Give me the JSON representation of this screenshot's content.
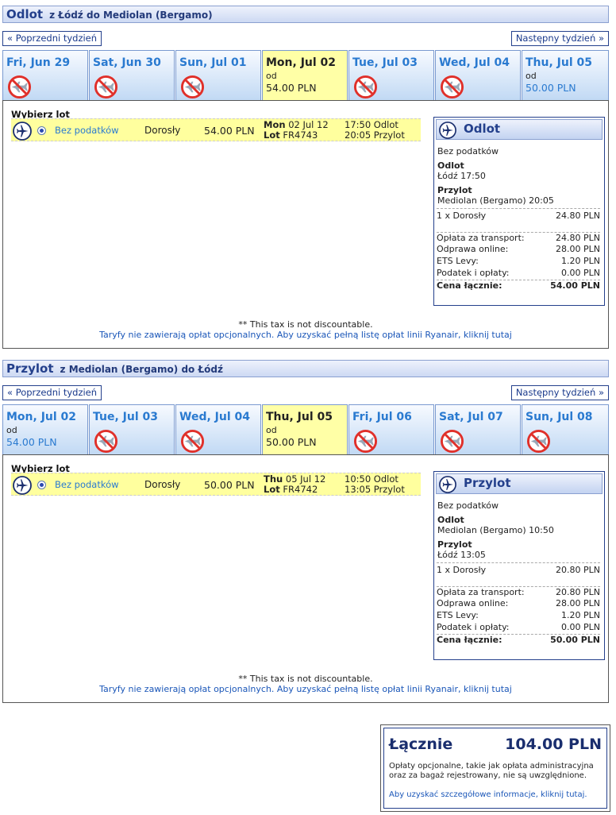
{
  "outbound": {
    "title": "Odlot",
    "route": "z Łódź do Mediolan (Bergamo)",
    "prev_week": "« Poprzedni tydzień",
    "next_week": "Następny tydzień »",
    "days": [
      {
        "label": "Fri, Jun 29",
        "available": false
      },
      {
        "label": "Sat, Jun 30",
        "available": false
      },
      {
        "label": "Sun, Jul 01",
        "available": false
      },
      {
        "label": "Mon, Jul 02",
        "available": true,
        "selected": true,
        "from": "od",
        "price": "54.00 PLN"
      },
      {
        "label": "Tue, Jul 03",
        "available": false
      },
      {
        "label": "Wed, Jul 04",
        "available": false
      },
      {
        "label": "Thu, Jul 05",
        "available": true,
        "selected": false,
        "from": "od",
        "price": "50.00 PLN"
      }
    ],
    "choose_flight": "Wybierz lot",
    "flight": {
      "fare": "Bez podatków",
      "pax": "Dorosły",
      "price": "54.00 PLN",
      "day": "Mon",
      "date": "02 Jul 12",
      "lot_label": "Lot",
      "flight_no": "FR4743",
      "dep": "17:50 Odlot",
      "arr": "20:05 Przylot"
    },
    "summary": {
      "title": "Odlot",
      "fare": "Bez podatków",
      "dep_label": "Odlot",
      "dep_value": "Łódź 17:50",
      "arr_label": "Przylot",
      "arr_value": "Mediolan (Bergamo) 20:05",
      "pax_label": "1 x Dorosły",
      "pax_value": "24.80 PLN",
      "rows": [
        {
          "label": "Opłata za transport:",
          "value": "24.80 PLN"
        },
        {
          "label": "Odprawa online:",
          "value": "28.00 PLN"
        },
        {
          "label": "ETS Levy:",
          "value": "1.20 PLN"
        },
        {
          "label": "Podatek i opłaty:",
          "value": "0.00 PLN"
        }
      ],
      "total_label": "Cena łącznie:",
      "total_value": "54.00 PLN"
    },
    "note1": "** This tax is not discountable.",
    "note2": "Taryfy nie zawierają opłat opcjonalnych. Aby uzyskać pełną listę opłat linii Ryanair, kliknij tutaj"
  },
  "inbound": {
    "title": "Przylot",
    "route": "z Mediolan (Bergamo) do Łódź",
    "prev_week": "« Poprzedni tydzień",
    "next_week": "Następny tydzień »",
    "days": [
      {
        "label": "Mon, Jul 02",
        "available": true,
        "selected": false,
        "from": "od",
        "price": "54.00 PLN"
      },
      {
        "label": "Tue, Jul 03",
        "available": false
      },
      {
        "label": "Wed, Jul 04",
        "available": false
      },
      {
        "label": "Thu, Jul 05",
        "available": true,
        "selected": true,
        "from": "od",
        "price": "50.00 PLN"
      },
      {
        "label": "Fri, Jul 06",
        "available": false
      },
      {
        "label": "Sat, Jul 07",
        "available": false
      },
      {
        "label": "Sun, Jul 08",
        "available": false
      }
    ],
    "choose_flight": "Wybierz lot",
    "flight": {
      "fare": "Bez podatków",
      "pax": "Dorosły",
      "price": "50.00 PLN",
      "day": "Thu",
      "date": "05 Jul 12",
      "lot_label": "Lot",
      "flight_no": "FR4742",
      "dep": "10:50 Odlot",
      "arr": "13:05 Przylot"
    },
    "summary": {
      "title": "Przylot",
      "fare": "Bez podatków",
      "dep_label": "Odlot",
      "dep_value": "Mediolan (Bergamo) 10:50",
      "arr_label": "Przylot",
      "arr_value": "Łódź 13:05",
      "pax_label": "1 x Dorosły",
      "pax_value": "20.80 PLN",
      "rows": [
        {
          "label": "Opłata za transport:",
          "value": "20.80 PLN"
        },
        {
          "label": "Odprawa online:",
          "value": "28.00 PLN"
        },
        {
          "label": "ETS Levy:",
          "value": "1.20 PLN"
        },
        {
          "label": "Podatek i opłaty:",
          "value": "0.00 PLN"
        }
      ],
      "total_label": "Cena łącznie:",
      "total_value": "50.00 PLN"
    },
    "note1": "** This tax is not discountable.",
    "note2": "Taryfy nie zawierają opłat opcjonalnych. Aby uzyskać pełną listę opłat linii Ryanair, kliknij tutaj"
  },
  "total": {
    "label": "Łącznie",
    "amount": "104.00 PLN",
    "info": "Opłaty opcjonalne, takie jak opłata administracyjna oraz za bagaż rejestrowany, nie są uwzględnione.",
    "link": "Aby uzyskać szczegółowe informacje, kliknij tutaj."
  },
  "icons": {
    "plane": "plane-icon",
    "no_flight": "no-flight-icon"
  },
  "colors": {
    "accent": "#24408c",
    "link": "#2a7ad0",
    "selected_day": "#ffffa6",
    "no_flight_red": "#e0302a"
  }
}
